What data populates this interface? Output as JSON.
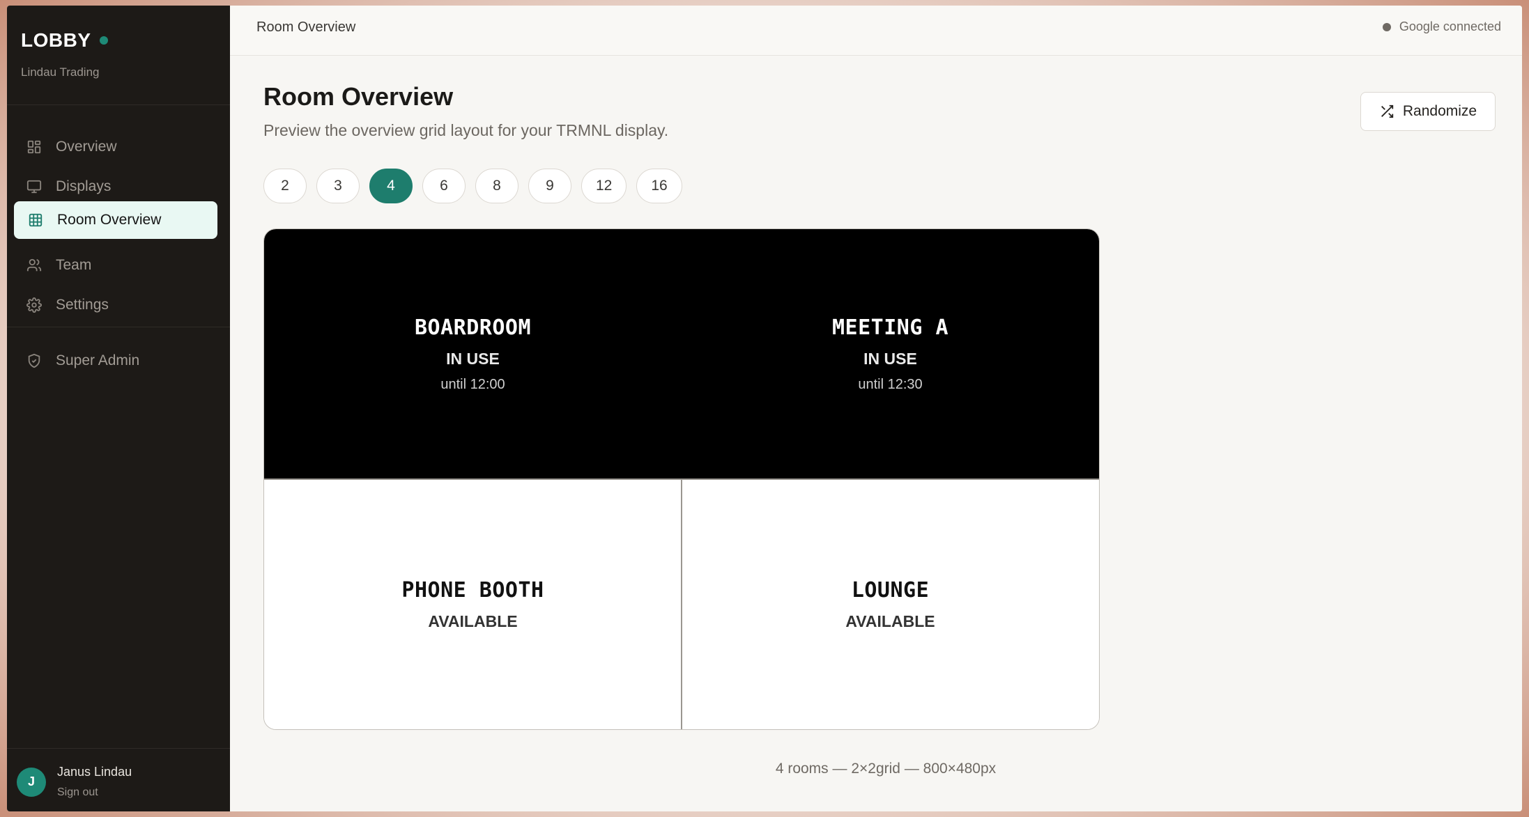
{
  "sidebar": {
    "brand": "LOBBY",
    "org": "Lindau Trading",
    "nav": [
      {
        "label": "Overview",
        "icon": "grid-icon"
      },
      {
        "label": "Displays",
        "icon": "monitor-icon"
      },
      {
        "label": "Room Overview",
        "icon": "table-icon",
        "active": true
      },
      {
        "label": "Team",
        "icon": "users-icon"
      },
      {
        "label": "Settings",
        "icon": "gear-icon"
      }
    ],
    "admin": {
      "label": "Super Admin",
      "icon": "shield-icon"
    },
    "user": {
      "initial": "J",
      "name": "Janus Lindau",
      "signout": "Sign out"
    }
  },
  "topbar": {
    "breadcrumb": "Room Overview",
    "google_status": "Google connected"
  },
  "main": {
    "title": "Room Overview",
    "subtitle": "Preview the overview grid layout for your TRMNL display.",
    "randomize_label": "Randomize",
    "pills": [
      "2",
      "3",
      "4",
      "6",
      "8",
      "9",
      "12",
      "16"
    ],
    "selected_pill": "4",
    "rooms": [
      {
        "name": "BOARDROOM",
        "status": "IN USE",
        "until": "until 12:00",
        "theme": "dark"
      },
      {
        "name": "MEETING A",
        "status": "IN USE",
        "until": "until 12:30",
        "theme": "dark"
      },
      {
        "name": "PHONE BOOTH",
        "status": "AVAILABLE",
        "until": "",
        "theme": "light"
      },
      {
        "name": "LOUNGE",
        "status": "AVAILABLE",
        "until": "",
        "theme": "light"
      }
    ],
    "caption": "4 rooms — 2×2grid — 800×480px"
  },
  "colors": {
    "accent": "#1e7d6d",
    "sidebar_bg": "#1d1a17",
    "active_nav_bg": "#e9f8f3"
  }
}
